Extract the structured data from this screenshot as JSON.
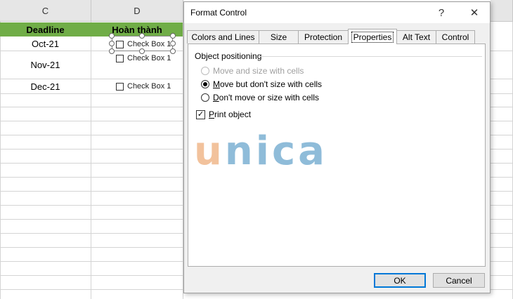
{
  "sheet": {
    "columns": [
      {
        "label": "C"
      },
      {
        "label": "D"
      }
    ],
    "header_cells": {
      "deadline": "Deadline",
      "done": "Hoàn thành"
    },
    "rows": [
      {
        "deadline": "Oct-21",
        "checkbox": "Check Box 1"
      },
      {
        "deadline": "Nov-21",
        "checkbox": "Check Box 1"
      },
      {
        "deadline": "Dec-21",
        "checkbox": "Check Box 1"
      }
    ],
    "header_color": "#70ad47"
  },
  "dialog": {
    "title": "Format Control",
    "help_label": "?",
    "close_label": "✕",
    "tabs": [
      {
        "label": "Colors and Lines",
        "active": false
      },
      {
        "label": "Size",
        "active": false
      },
      {
        "label": "Protection",
        "active": false
      },
      {
        "label": "Properties",
        "active": true
      },
      {
        "label": "Alt Text",
        "active": false
      },
      {
        "label": "Control",
        "active": false
      }
    ],
    "group_label": "Object positioning",
    "options": {
      "move_and_size": "Move and size with cells",
      "move_not_size_prefix": "",
      "move_not_size_accel": "M",
      "move_not_size_rest": "ove but don't size with cells",
      "dont_move_accel": "D",
      "dont_move_rest": "on't move or size with cells"
    },
    "selected_option": "move_not_size",
    "print_accel": "P",
    "print_rest": "rint object",
    "print_checked": true,
    "check_glyph": "✓",
    "watermark": {
      "text": "unica",
      "letters": [
        "u",
        "n",
        "i",
        "c",
        "a"
      ],
      "colors": [
        "#f2c29c",
        "#8fbcd9",
        "#8fbcd9",
        "#8fbcd9",
        "#8fbcd9"
      ]
    },
    "ok_label": "OK",
    "cancel_label": "Cancel",
    "accent": "#0078d7"
  }
}
